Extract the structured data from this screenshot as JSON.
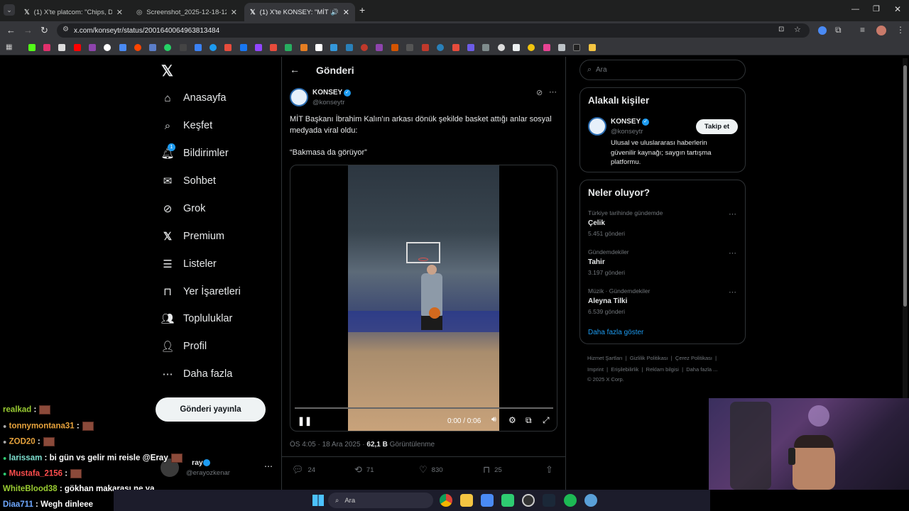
{
  "browser": {
    "tabs": [
      {
        "title": "(1) X'te platcom: \"Chips, Dubai"
      },
      {
        "title": "Screenshot_2025-12-18-12-29-"
      },
      {
        "title": "(1) X'te KONSEY: \"MİT Başk"
      }
    ],
    "url": "x.com/konseytr/status/2001640064963813484"
  },
  "sidebar": {
    "items": [
      {
        "label": "Anasayfa",
        "icon": "home-icon"
      },
      {
        "label": "Keşfet",
        "icon": "search-icon"
      },
      {
        "label": "Bildirimler",
        "icon": "bell-icon",
        "badge": "1"
      },
      {
        "label": "Sohbet",
        "icon": "mail-icon"
      },
      {
        "label": "Grok",
        "icon": "grok-icon"
      },
      {
        "label": "Premium",
        "icon": "x-logo-icon"
      },
      {
        "label": "Listeler",
        "icon": "list-icon"
      },
      {
        "label": "Yer İşaretleri",
        "icon": "bookmark-icon"
      },
      {
        "label": "Topluluklar",
        "icon": "people-icon"
      },
      {
        "label": "Profil",
        "icon": "person-icon"
      },
      {
        "label": "Daha fazla",
        "icon": "more-circle-icon"
      }
    ],
    "post_button": "Gönderi yayınla",
    "account": {
      "name": "ray",
      "handle": "@erayozkenar"
    }
  },
  "main": {
    "header": "Gönderi",
    "post": {
      "author": "KONSEY",
      "handle": "@konseytr",
      "text1": "MİT Başkanı İbrahim Kalın'ın arkası dönük şekilde basket attığı anlar sosyal medyada viral oldu:",
      "text2": "“Bakmasa da görüyor”",
      "video_time": "0:00 / 0:06",
      "timestamp": "ÖS 4:05 · 18 Ara 2025 · ",
      "views_count": "62,1 B",
      "views_label": " Görüntülenme",
      "replies": "24",
      "reposts": "71",
      "likes": "830",
      "bookmarks": "25"
    }
  },
  "right": {
    "search_placeholder": "Ara",
    "relevant": {
      "title": "Alakalı kişiler",
      "name": "KONSEY",
      "handle": "@konseytr",
      "follow": "Takip et",
      "bio": "Ulusal ve uluslararası haberlerin güvenilir kaynağı; saygın tartışma platformu."
    },
    "trends": {
      "title": "Neler oluyor?",
      "items": [
        {
          "cat": "Türkiye tarihinde gündemde",
          "name": "Çelik",
          "count": "5.451 gönderi"
        },
        {
          "cat": "Gündemdekiler",
          "name": "Tahir",
          "count": "3.197 gönderi"
        },
        {
          "cat": "Müzik · Gündemdekiler",
          "name": "Aleyna Tilki",
          "count": "6.539 gönderi"
        }
      ],
      "more": "Daha fazla göster"
    },
    "footer": {
      "line1": "Hizmet Şartları  |  Gizlilik Politikası  |  Çerez Politikası  |",
      "line2": "Imprint  |  Erişilebilirlik  |  Reklam bilgisi  |  Daha fazla ...",
      "line3": "© 2025 X Corp."
    }
  },
  "chat": [
    {
      "user": "realkad",
      "msg": "",
      "color": "#9acd32",
      "emote": true
    },
    {
      "user": "tonnymontana31",
      "msg": "",
      "color": "#e6a23c",
      "emote": true
    },
    {
      "user": "ZOD20",
      "msg": "",
      "color": "#e6a23c",
      "emote": true
    },
    {
      "user": "larissam",
      "msg": "bi gün vs gelir mi reisle @Eray",
      "color": "#7ee0d0",
      "emote": true
    },
    {
      "user": "Mustafa_2156",
      "msg": "",
      "color": "#ff4d4d",
      "emote": true
    },
    {
      "user": "WhiteBlood38",
      "msg": "gökhan makarası ne ya",
      "color": "#9acd32",
      "emote": false
    },
    {
      "user": "Diaa711",
      "msg": "Wegh dinleee",
      "color": "#6fa8ff",
      "emote": false
    }
  ],
  "taskbar": {
    "search": "Ara"
  }
}
